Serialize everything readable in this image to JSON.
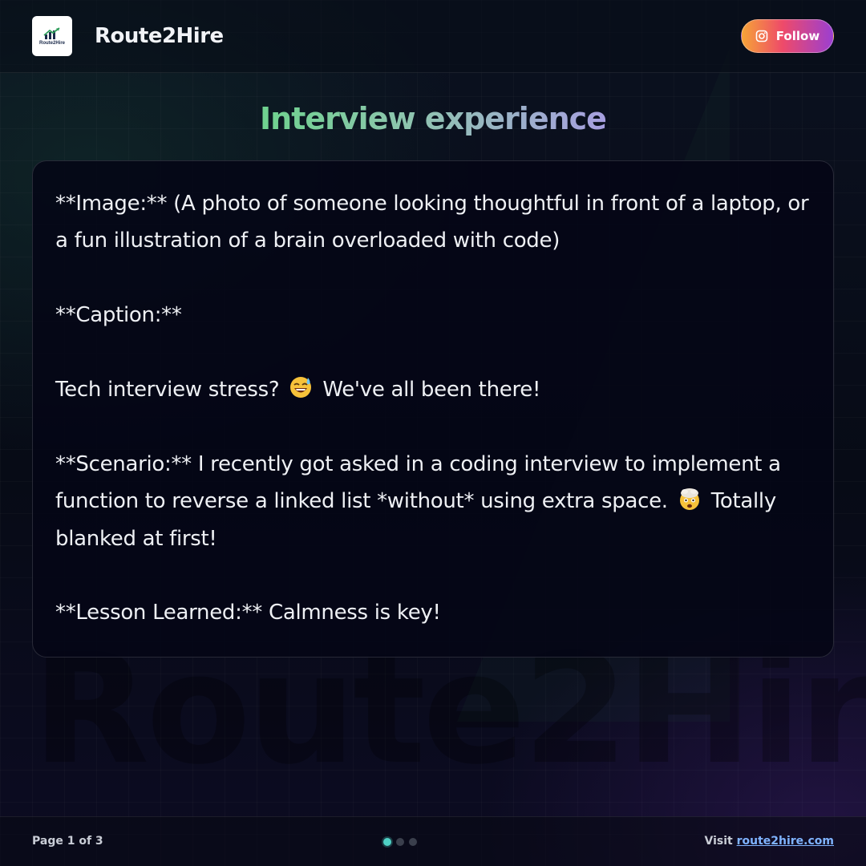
{
  "header": {
    "logo_text": "Route2Hire",
    "brand_name": "Route2Hire",
    "follow_label": "Follow",
    "follow_icon": "instagram-icon"
  },
  "title": "Interview experience",
  "watermark": "Route2Hire",
  "post": {
    "line1": "**Image:** (A photo of someone looking thoughtful in front of a laptop, or a fun illustration of a brain overloaded with code)",
    "caption_heading": "**Caption:**",
    "line3_before": "Tech interview stress?",
    "line3_emoji": "grinning-sweat-emoji",
    "line3_after": "We've all been there!",
    "scenario_before": "**Scenario:** I recently got asked in a coding interview to implement a function to reverse a linked list *without* using extra space.",
    "scenario_emoji": "exploding-head-emoji",
    "scenario_after": "Totally blanked at first!",
    "lesson": "**Lesson Learned:** Calmness is key!"
  },
  "footer": {
    "page_label": "Page 1 of 3",
    "current_page": 1,
    "total_pages": 3,
    "visit_label": "Visit",
    "visit_link": "route2hire.com"
  },
  "colors": {
    "accent_teal": "#4fd1c5",
    "title_gradient_start": "#6ed38e",
    "title_gradient_end": "#a79fe0",
    "link": "#7fb3ff"
  }
}
